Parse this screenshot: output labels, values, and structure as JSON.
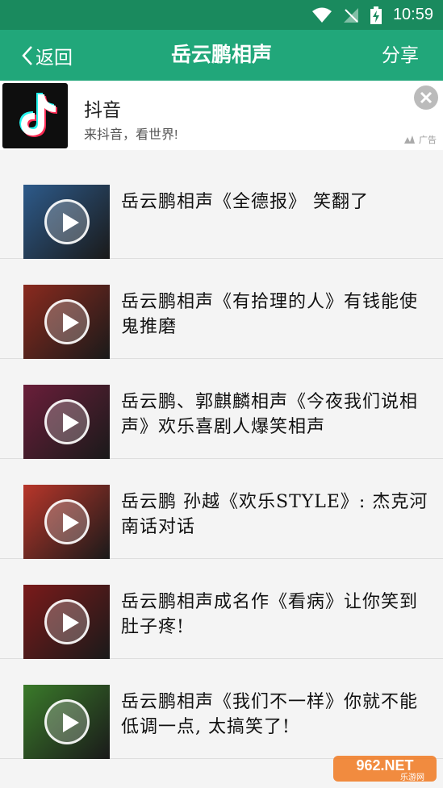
{
  "status_bar": {
    "time": "10:59"
  },
  "app_bar": {
    "back_label": "返回",
    "title": "岳云鹏相声",
    "share_label": "分享"
  },
  "ad": {
    "title": "抖音",
    "subtitle": "来抖音，看世界!",
    "badge": "广告"
  },
  "items": [
    {
      "title": "岳云鹏相声《全德报》 笑翻了",
      "thumb_color": "#2d5a8a"
    },
    {
      "title": "岳云鹏相声《有拾理的人》有钱能使鬼推磨",
      "thumb_color": "#8a2a1e"
    },
    {
      "title": "岳云鹏、郭麒麟相声《今夜我们说相声》欢乐喜剧人爆笑相声",
      "thumb_color": "#6a1e3a"
    },
    {
      "title": "岳云鹏 孙越《欢乐STYLE》: 杰克河南话对话",
      "thumb_color": "#b8362a"
    },
    {
      "title": "岳云鹏相声成名作《看病》让你笑到肚子疼!",
      "thumb_color": "#7a1a1a"
    },
    {
      "title": "岳云鹏相声《我们不一样》你就不能低调一点, 太搞笑了!",
      "thumb_color": "#3a7a2a"
    }
  ],
  "watermark": {
    "text": "962.NET",
    "sub": "乐游网"
  }
}
